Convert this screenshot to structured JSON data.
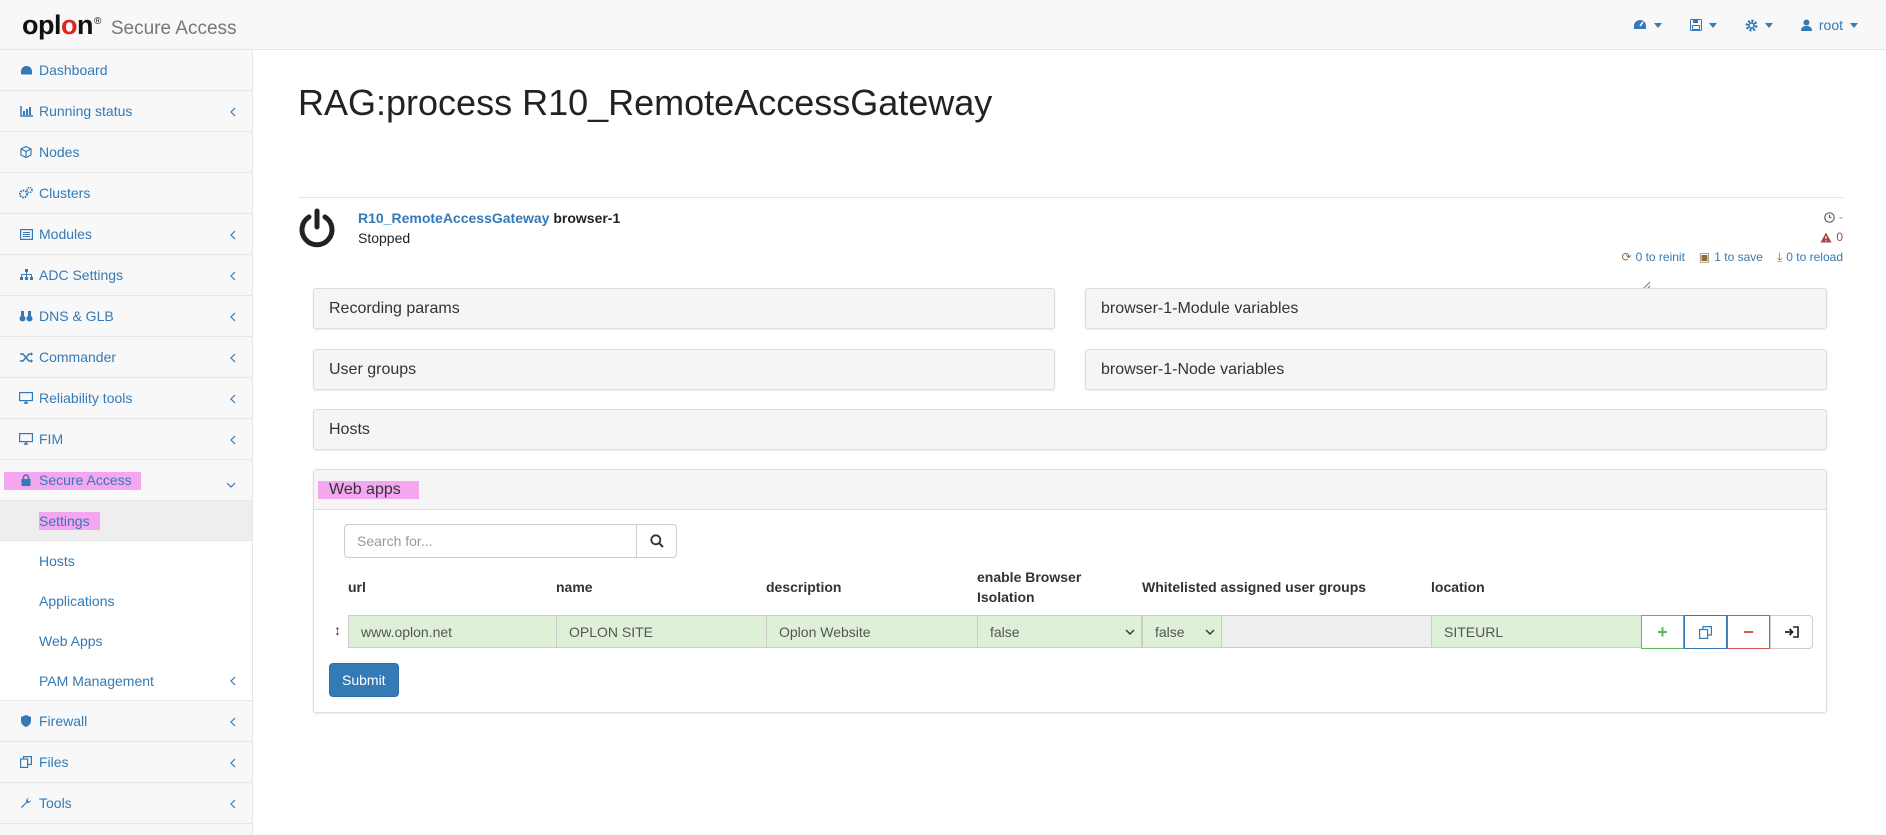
{
  "header": {
    "logo_text": "oplon",
    "logo_mark": "®",
    "app_title": "Secure Access",
    "user_label": "root"
  },
  "sidebar": {
    "items": [
      {
        "label": "Dashboard"
      },
      {
        "label": "Running status"
      },
      {
        "label": "Nodes"
      },
      {
        "label": "Clusters"
      },
      {
        "label": "Modules"
      },
      {
        "label": "ADC Settings"
      },
      {
        "label": "DNS & GLB"
      },
      {
        "label": "Commander"
      },
      {
        "label": "Reliability tools"
      },
      {
        "label": "FIM"
      },
      {
        "label": "Secure Access"
      },
      {
        "label": "Firewall"
      },
      {
        "label": "Files"
      },
      {
        "label": "Tools"
      }
    ],
    "secure_access_sub": [
      {
        "label": "Settings"
      },
      {
        "label": "Hosts"
      },
      {
        "label": "Applications"
      },
      {
        "label": "Web Apps"
      },
      {
        "label": "PAM Management"
      }
    ]
  },
  "main": {
    "title": "RAG:process R10_RemoteAccessGateway",
    "process": {
      "link": "R10_RemoteAccessGateway",
      "node": "browser-1",
      "state": "Stopped",
      "time_value": "-",
      "warnings": "0",
      "to_reinit": "0 to reinit",
      "to_save": "1 to save",
      "to_reload": "0 to reload"
    },
    "panels": {
      "recording": "Recording params",
      "module_vars": "browser-1-Module variables",
      "user_groups": "User groups",
      "node_vars": "browser-1-Node variables",
      "hosts": "Hosts",
      "web_apps": "Web apps"
    },
    "search": {
      "placeholder": "Search for..."
    },
    "table": {
      "headers": {
        "url": "url",
        "name": "name",
        "description": "description",
        "isolation_1": "enable Browser",
        "isolation_2": "Isolation",
        "whitelisted": "Whitelisted assigned user groups",
        "location": "location"
      },
      "row": {
        "url": "www.oplon.net",
        "name": "OPLON SITE",
        "description": "Oplon Website",
        "isolation": "false",
        "whitelisted": "false",
        "groups": "",
        "location": "SITEURL"
      }
    },
    "submit_label": "Submit"
  },
  "colors": {
    "link": "#337ab7",
    "highlight": "#f4a6f0",
    "cell_bg": "#dff0d8",
    "primary": "#337ab7",
    "logo_red": "#e0241b"
  }
}
